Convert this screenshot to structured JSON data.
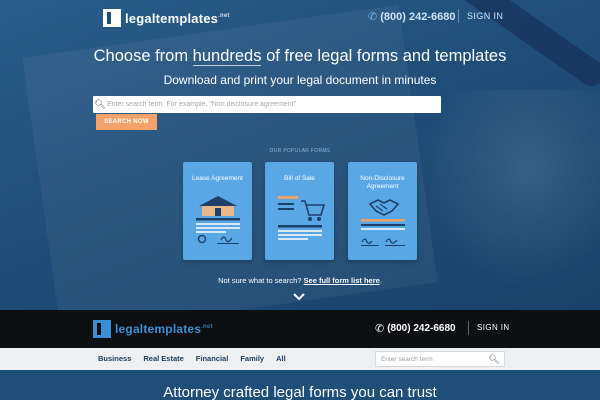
{
  "header": {
    "logo_text": "legaltemplates",
    "logo_tld": ".net",
    "phone": "(800) 242-6680",
    "signin_label": "SIGN IN"
  },
  "hero": {
    "headline_pre": "Choose from ",
    "headline_highlight": "hundreds",
    "headline_post": " of free legal forms and templates",
    "subheadline": "Download and print your legal document in minutes",
    "search_placeholder": "Enter search term. For example, \"Non disclosure agreement\"",
    "search_button": "SEARCH NOW",
    "popular_title": "OUR POPULAR FORMS",
    "cards": [
      {
        "title": "Lease Agreement",
        "icon": "house-icon"
      },
      {
        "title": "Bill of Sale",
        "icon": "cart-icon"
      },
      {
        "title": "Non-Disclosure Agreement",
        "icon": "handshake-icon"
      }
    ],
    "not_sure_text": "Not sure what to search?",
    "full_list_link": "See full form list here",
    "not_sure_suffix": "."
  },
  "sticky_bar": {
    "logo_text": "legaltemplates",
    "logo_tld": ".net",
    "phone": "(800) 242-6680",
    "signin_label": "SIGN IN"
  },
  "nav": {
    "items": [
      "Business",
      "Real Estate",
      "Financial",
      "Family",
      "All"
    ],
    "search_placeholder": "Enter search term"
  },
  "banner": {
    "title": "Attorney crafted legal forms you can trust"
  },
  "colors": {
    "accent_orange": "#f4a26b",
    "card_blue": "#5aa7e6",
    "hero_blue": "#1f4e79"
  }
}
